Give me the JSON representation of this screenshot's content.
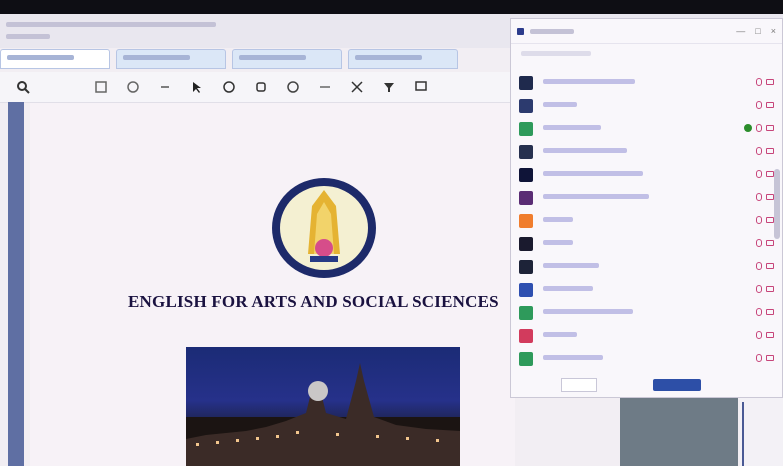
{
  "document": {
    "title": "ENGLISH FOR ARTS AND SOCIAL SCIENCES"
  },
  "participants_panel": {
    "rows": [
      {
        "avatar_color": "#1f2a4d",
        "status": "muted"
      },
      {
        "avatar_color": "#2c3a6e",
        "status": "muted"
      },
      {
        "avatar_color": "#2e9a5b",
        "status": "video-on"
      },
      {
        "avatar_color": "#26304f",
        "status": "muted"
      },
      {
        "avatar_color": "#0f1438",
        "status": "muted"
      },
      {
        "avatar_color": "#5a2c74",
        "status": "muted"
      },
      {
        "avatar_color": "#f07d2d",
        "status": "muted"
      },
      {
        "avatar_color": "#1a1a2e",
        "status": "muted"
      },
      {
        "avatar_color": "#1d2338",
        "status": "muted"
      },
      {
        "avatar_color": "#2e4fb0",
        "status": "muted"
      },
      {
        "avatar_color": "#2e9a5b",
        "status": "muted"
      },
      {
        "avatar_color": "#d23b5d",
        "status": "muted"
      },
      {
        "avatar_color": "#2e9a5b",
        "status": "muted"
      }
    ]
  },
  "colors": {
    "topbar": "#0e0e14",
    "accent": "#2d4fa7",
    "muted_icon": "#c7457a"
  }
}
